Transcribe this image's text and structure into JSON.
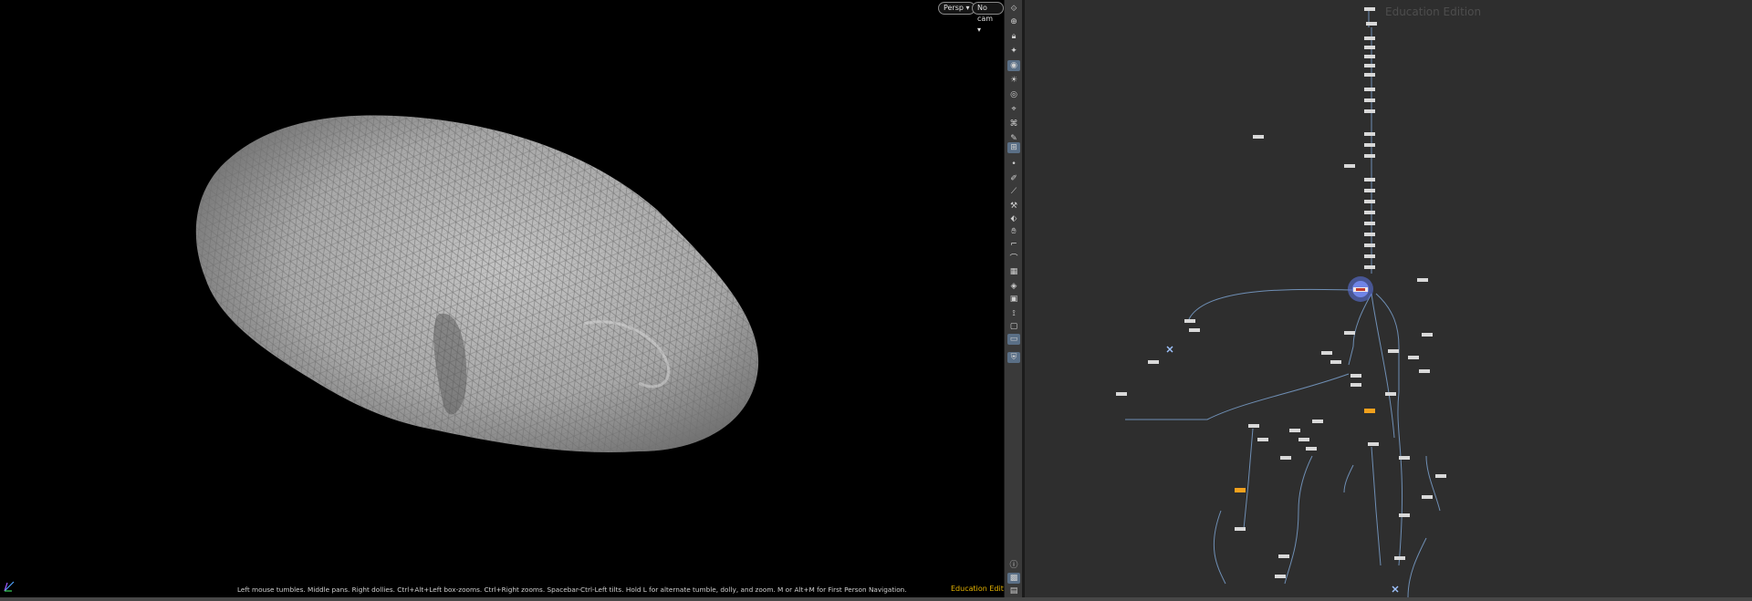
{
  "viewport": {
    "view_menu": "Persp ▾",
    "camera_menu": "No cam ▾",
    "hint": "Left mouse tumbles. Middle pans. Right dollies. Ctrl+Alt+Left box-zooms. Ctrl+Right zooms. Spacebar-Ctrl-Left tilts. Hold L for alternate tumble, dolly, and zoom.    M or Alt+M for First Person Navigation.",
    "edition_label": "Education Edition",
    "geometry_name": "triangulated-mesh"
  },
  "toolbar": {
    "tools": [
      "select-icon",
      "transform-icon",
      "lock-icon",
      "handle-icon",
      "view-icon",
      "light-icon",
      "bulb-icon",
      "pin-icon",
      "snap-icon",
      "brush-icon",
      "measure-icon",
      "dot-icon",
      "pen-icon",
      "knife-icon",
      "sculpt-icon",
      "paint-icon",
      "hand-icon",
      "ruler-icon",
      "curve-icon",
      "grid-icon",
      "flip-icon",
      "image-icon",
      "bone-icon",
      "cube-icon",
      "camera-icon",
      "shield-icon"
    ],
    "bottom_tools": [
      "info-icon",
      "layout-icon",
      "display-icon"
    ]
  },
  "network": {
    "watermark": "Education Edition",
    "highlight_color": "#5a72d8",
    "selected_node_color": "#d9d9d9",
    "accent_node_color": "#f2a11d"
  }
}
